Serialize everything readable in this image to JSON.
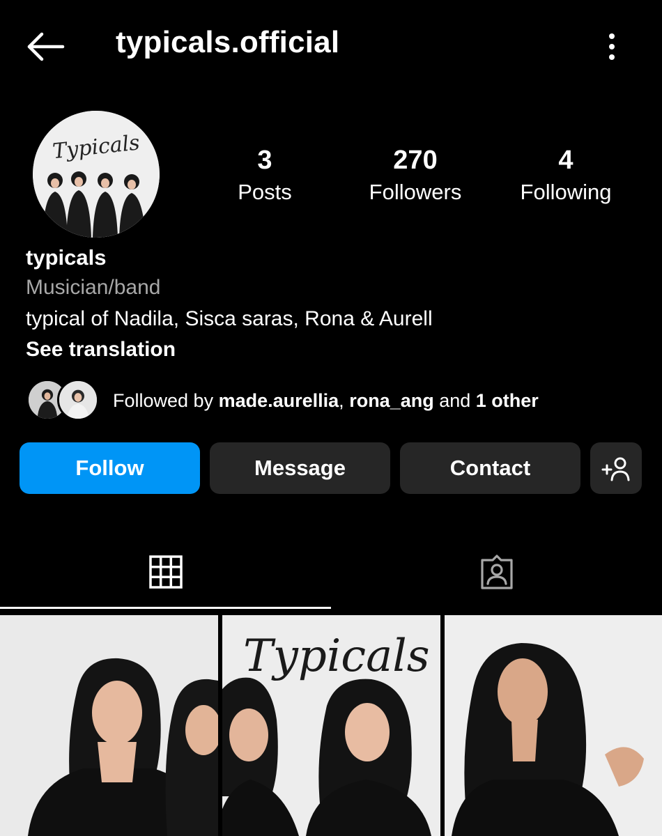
{
  "header": {
    "username": "typicals.official",
    "back_icon": "arrow-left-icon",
    "more_icon": "more-vertical-icon"
  },
  "avatar": {
    "logo_text": "Typicals"
  },
  "stats": [
    {
      "value": "3",
      "label": "Posts"
    },
    {
      "value": "270",
      "label": "Followers"
    },
    {
      "value": "4",
      "label": "Following"
    }
  ],
  "profile": {
    "name": "typicals",
    "category": "Musician/band",
    "bio": "typical of Nadila, Sisca saras, Rona & Aurell",
    "see_translation": "See translation"
  },
  "followed_by": {
    "prefix": "Followed by ",
    "user1": "made.aurellia",
    "separator": ", ",
    "user2": "rona_ang",
    "middle": " and ",
    "others": "1 other"
  },
  "actions": {
    "follow": "Follow",
    "message": "Message",
    "contact": "Contact",
    "add_user_icon": "add-user-icon"
  },
  "tabs": [
    {
      "icon": "grid-icon",
      "active": true
    },
    {
      "icon": "tagged-person-icon",
      "active": false
    }
  ],
  "posts": {
    "banner_text": "Typicals"
  },
  "colors": {
    "background": "#000000",
    "accent": "#0095f6",
    "button_secondary": "#262626",
    "muted_text": "#a8a8a8"
  }
}
